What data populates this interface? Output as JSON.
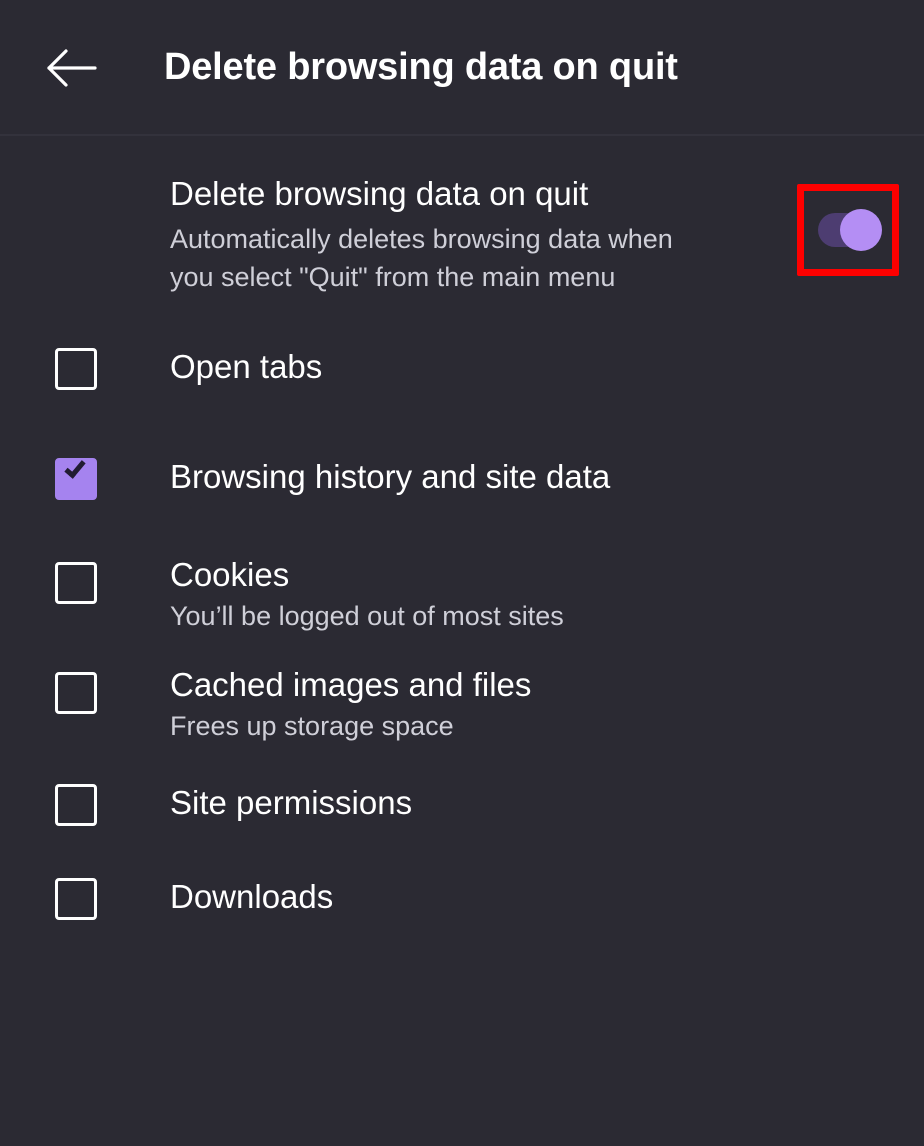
{
  "app": {
    "theme": "dark",
    "background_color": "#2b2a33",
    "accent_color": "#a583ef",
    "highlight_color": "#fe0000"
  },
  "header": {
    "back_icon": "arrow-left-icon",
    "title": "Delete browsing data on quit"
  },
  "main_preference": {
    "title": "Delete browsing data on quit",
    "summary": "Automatically deletes browsing data when you select \"Quit\" from the main menu",
    "toggle": {
      "name": "delete-on-quit-toggle",
      "state": "on",
      "track_color": "#4d3d71",
      "thumb_color": "#b48ef4",
      "highlighted": true
    }
  },
  "data_items": [
    {
      "id": "open-tabs",
      "label": "Open tabs",
      "sublabel": "",
      "checked": false
    },
    {
      "id": "browsing-history-and-site-data",
      "label": "Browsing history and site data",
      "sublabel": "",
      "checked": true
    },
    {
      "id": "cookies",
      "label": "Cookies",
      "sublabel": "You’ll be logged out of most sites",
      "checked": false
    },
    {
      "id": "cached-images-and-files",
      "label": "Cached images and files",
      "sublabel": "Frees up storage space",
      "checked": false
    },
    {
      "id": "site-permissions",
      "label": "Site permissions",
      "sublabel": "",
      "checked": false
    },
    {
      "id": "downloads",
      "label": "Downloads",
      "sublabel": "",
      "checked": false
    }
  ]
}
